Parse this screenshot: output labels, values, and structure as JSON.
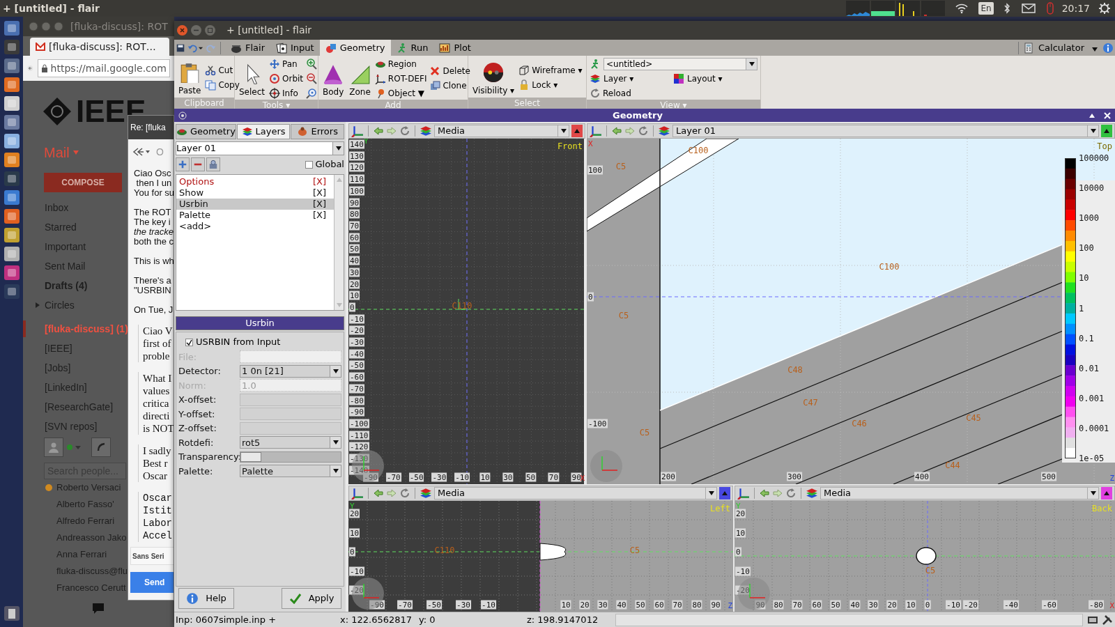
{
  "top_panel": {
    "title": "+ [untitled] - flair",
    "keyboard": "En",
    "time": "20:17"
  },
  "browser": {
    "window_title": "[fluka-discuss]: ROT",
    "tab": "[fluka-discuss]: ROT…",
    "url": "https://mail.google.com",
    "logo": "IEEE"
  },
  "gmail": {
    "mail_menu": "Mail",
    "compose": "COMPOSE",
    "labels": [
      {
        "text": "Inbox",
        "bold": false,
        "selected": false,
        "expandable": false
      },
      {
        "text": "Starred",
        "bold": false,
        "selected": false,
        "expandable": false
      },
      {
        "text": "Important",
        "bold": false,
        "selected": false,
        "expandable": false
      },
      {
        "text": "Sent Mail",
        "bold": false,
        "selected": false,
        "expandable": false
      },
      {
        "text": "Drafts (4)",
        "bold": true,
        "selected": false,
        "expandable": false
      },
      {
        "text": "Circles",
        "bold": false,
        "selected": false,
        "expandable": true
      },
      {
        "text": "[fluka-discuss] (1)",
        "bold": true,
        "selected": true,
        "expandable": false
      },
      {
        "text": "[IEEE]",
        "bold": false,
        "selected": false,
        "expandable": false
      },
      {
        "text": "[Jobs]",
        "bold": false,
        "selected": false,
        "expandable": false
      },
      {
        "text": "[LinkedIn]",
        "bold": false,
        "selected": false,
        "expandable": false
      },
      {
        "text": "[ResearchGate]",
        "bold": false,
        "selected": false,
        "expandable": false
      },
      {
        "text": "[SVN repos]",
        "bold": false,
        "selected": false,
        "expandable": false
      }
    ],
    "search_people": {
      "placeholder": "Search people..."
    },
    "contacts": [
      {
        "name": "Roberto Versaci",
        "away": true
      },
      {
        "name": "Alberto Fasso'",
        "away": false
      },
      {
        "name": "Alfredo Ferrari",
        "away": false
      },
      {
        "name": "Andreasson Jako",
        "away": false
      },
      {
        "name": "Anna Ferrari",
        "away": false
      },
      {
        "name": "fluka-discuss@flu",
        "away": false
      },
      {
        "name": "Francesco Cerutt",
        "away": false
      }
    ]
  },
  "compose_window": {
    "title": "Re: [fluka",
    "to_hint": "O",
    "paragraphs": [
      {
        "kind": "sans",
        "lines": [
          "Ciao Osc",
          " then I un",
          "You for su"
        ]
      },
      {
        "kind": "sans",
        "lines": [
          "The ROT",
          "The key i",
          "*the tracke*",
          "both the c"
        ]
      },
      {
        "kind": "sans",
        "lines": [
          "This is wh"
        ]
      },
      {
        "kind": "sans",
        "lines": [
          "There's a",
          "\"USRBIN"
        ]
      },
      {
        "kind": "sans",
        "lines": [
          "On Tue, J"
        ]
      },
      {
        "kind": "quote",
        "lines": [
          "Ciao V",
          "first of",
          "proble"
        ]
      },
      {
        "kind": "quote",
        "lines": [
          "What I",
          "values",
          "critica",
          "directi",
          "is NOT"
        ]
      },
      {
        "kind": "quote",
        "lines": [
          "I sadly",
          "Best r",
          "Oscar"
        ]
      },
      {
        "kind": "quote_mono",
        "lines": [
          "Oscar",
          "Istit",
          "Labor",
          "Accel"
        ]
      }
    ],
    "font_menu": "Sans Seri",
    "send": "Send"
  },
  "flair": {
    "title": "+ [untitled] - flair",
    "tabs": [
      {
        "label": "Flair",
        "selected": false
      },
      {
        "label": "Input",
        "selected": false
      },
      {
        "label": "Geometry",
        "selected": true
      },
      {
        "label": "Run",
        "selected": false
      },
      {
        "label": "Plot",
        "selected": false
      }
    ],
    "calculator": "Calculator",
    "ribbon": [
      {
        "label": "Clipboard",
        "columns": [
          [
            {
              "kind": "large",
              "label": "Paste"
            }
          ],
          [
            {
              "kind": "small",
              "label": "Cut"
            },
            {
              "kind": "small",
              "label": "Copy"
            }
          ]
        ]
      },
      {
        "label": "Tools ▾",
        "columns": [
          [
            {
              "kind": "large",
              "label": "Select"
            }
          ],
          [
            {
              "kind": "small",
              "label": "Pan"
            },
            {
              "kind": "small",
              "label": "Orbit"
            },
            {
              "kind": "small",
              "label": "Info"
            }
          ],
          [
            {
              "kind": "icon"
            },
            {
              "kind": "icon"
            },
            {
              "kind": "icon"
            }
          ]
        ]
      },
      {
        "label": "Add",
        "columns": [
          [
            {
              "kind": "large",
              "label": "Body"
            }
          ],
          [
            {
              "kind": "large",
              "label": "Zone"
            }
          ],
          [
            {
              "kind": "small",
              "label": "Region"
            },
            {
              "kind": "small",
              "label": "ROT-DEFI"
            },
            {
              "kind": "small",
              "label": "Object ▼"
            }
          ],
          [
            {
              "kind": "small",
              "label": "Delete"
            },
            {
              "kind": "small",
              "label": "Clone"
            }
          ]
        ]
      },
      {
        "label": "Select",
        "columns": [
          [
            {
              "kind": "large",
              "label": "Visibility ▾"
            }
          ],
          [
            {
              "kind": "small",
              "label": "Wireframe ▾"
            },
            {
              "kind": "small",
              "label": "Lock ▾"
            }
          ]
        ]
      },
      {
        "label": "View ▾",
        "columns": [
          [
            {
              "kind": "combo",
              "label": "<untitled>"
            },
            {
              "kind": "pair",
              "label": "Layer ▾",
              "label2": "Layout ▾"
            },
            {
              "kind": "small",
              "label": "Reload"
            }
          ]
        ]
      }
    ],
    "geometry_title": "Geometry",
    "panel": {
      "tabs": [
        {
          "label": "Geometry",
          "selected": false
        },
        {
          "label": "Layers",
          "selected": true
        },
        {
          "label": "Errors",
          "selected": false
        }
      ],
      "layer": "Layer 01",
      "global": {
        "label": "Global",
        "checked": false
      },
      "items": [
        {
          "label": "Options",
          "flag": "[X]",
          "highlighted": true,
          "selected": false
        },
        {
          "label": "Show",
          "flag": "[X]",
          "highlighted": false,
          "selected": false
        },
        {
          "label": "Usrbin",
          "flag": "[X]",
          "highlighted": false,
          "selected": true
        },
        {
          "label": "Palette",
          "flag": "[X]",
          "highlighted": false,
          "selected": false
        },
        {
          "label": "<add>",
          "highlighted": false,
          "selected": false
        }
      ],
      "section": "Usrbin",
      "from_input": {
        "label": "USRBIN from Input",
        "checked": true
      },
      "fields": [
        {
          "label": "File:",
          "kind": "text",
          "disabled": true
        },
        {
          "label": "Detector:",
          "kind": "combo",
          "value": "1 0n [21]",
          "disabled": false
        },
        {
          "label": "Norm:",
          "kind": "text",
          "value": "1.0",
          "disabled": true
        },
        {
          "label": "X-offset:",
          "kind": "text",
          "disabled": false
        },
        {
          "label": "Y-offset:",
          "kind": "text",
          "disabled": false
        },
        {
          "label": "Z-offset:",
          "kind": "text",
          "disabled": false
        },
        {
          "label": "Rotdefi:",
          "kind": "combo",
          "value": "rot5",
          "disabled": false
        },
        {
          "label": "Transparency:",
          "kind": "slider",
          "level": 0,
          "disabled": false
        },
        {
          "label": "Palette:",
          "kind": "combo",
          "value": "Palette",
          "disabled": false
        }
      ],
      "help": "Help",
      "apply": "Apply"
    },
    "viewports": [
      {
        "kind": "front",
        "layer": "Media",
        "view": "Front",
        "color": "#e04848",
        "y_axis": "Y",
        "x_axis": "X",
        "yticks": [
          "140",
          "130",
          "120",
          "110",
          "100",
          "90",
          "80",
          "70",
          "60",
          "50",
          "40",
          "30",
          "20",
          "10",
          "0",
          "-10",
          "-20",
          "-30",
          "-40",
          "-50",
          "-60",
          "-70",
          "-80",
          "-90",
          "-100",
          "-110",
          "-120",
          "-130",
          "-140"
        ],
        "xticks": [
          "-90",
          "-70",
          "-50",
          "-30",
          "-10",
          "10",
          "30",
          "50",
          "70",
          "90"
        ],
        "cells": [
          "C110"
        ]
      },
      {
        "kind": "top",
        "layer": "Layer 01",
        "view": "Top",
        "color": "#30c040",
        "y_axis": "X",
        "x_axis": "Z",
        "yticks": [
          "100",
          "0",
          "-100"
        ],
        "xticks": [
          "200",
          "300",
          "400",
          "500"
        ],
        "cells": [
          "C100",
          "C5",
          "C100",
          "C5",
          "C48",
          "C47",
          "C46",
          "C45",
          "C5",
          "C44"
        ],
        "scale": [
          "100000",
          "10000",
          "1000",
          "100",
          "10",
          "1",
          "0.1",
          "0.01",
          "0.001",
          "0.0001",
          "1e-05"
        ]
      },
      {
        "kind": "left",
        "layer": "Media",
        "view": "Left",
        "color": "#4848e0",
        "y_axis": "Y",
        "x_axis": "Z",
        "yticks": [
          "20",
          "10",
          "0",
          "-10",
          "-20"
        ],
        "xticks": [
          "-90",
          "-70",
          "-50",
          "-30",
          "-10",
          "10",
          "20",
          "30",
          "40",
          "50",
          "60",
          "70",
          "80",
          "90"
        ],
        "cells": [
          "C110",
          "C5"
        ]
      },
      {
        "kind": "back",
        "layer": "Media",
        "view": "Back",
        "color": "#e040e0",
        "y_axis": "Y",
        "x_axis": "X",
        "yticks": [
          "20",
          "10",
          "0",
          "-10",
          "-20"
        ],
        "xticks": [
          "90",
          "80",
          "70",
          "60",
          "50",
          "40",
          "30",
          "20",
          "10",
          "0",
          "-10",
          "-20",
          "-40",
          "-60",
          "-80"
        ],
        "cells": [
          "C5"
        ]
      }
    ],
    "status": {
      "file": "Inp: 0607simple.inp +",
      "x": "x: 122.6562817",
      "y": "y: 0",
      "z": "z: 198.9147012"
    }
  }
}
